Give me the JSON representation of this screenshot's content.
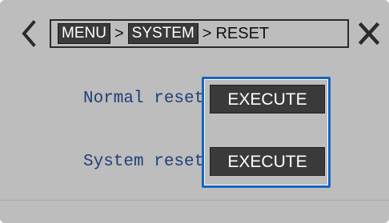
{
  "breadcrumb": {
    "items": [
      "MENU",
      "SYSTEM"
    ],
    "separator": ">",
    "current": "RESET"
  },
  "icons": {
    "back": "chevron-left-icon",
    "close": "close-icon"
  },
  "rows": [
    {
      "label": "Normal reset",
      "button": "EXECUTE"
    },
    {
      "label": "System reset",
      "button": "EXECUTE"
    }
  ],
  "colors": {
    "background": "#bdbdbd",
    "button": "#3a3a3a",
    "label_text": "#1f3f7a",
    "focus_frame": "#1565c0"
  }
}
